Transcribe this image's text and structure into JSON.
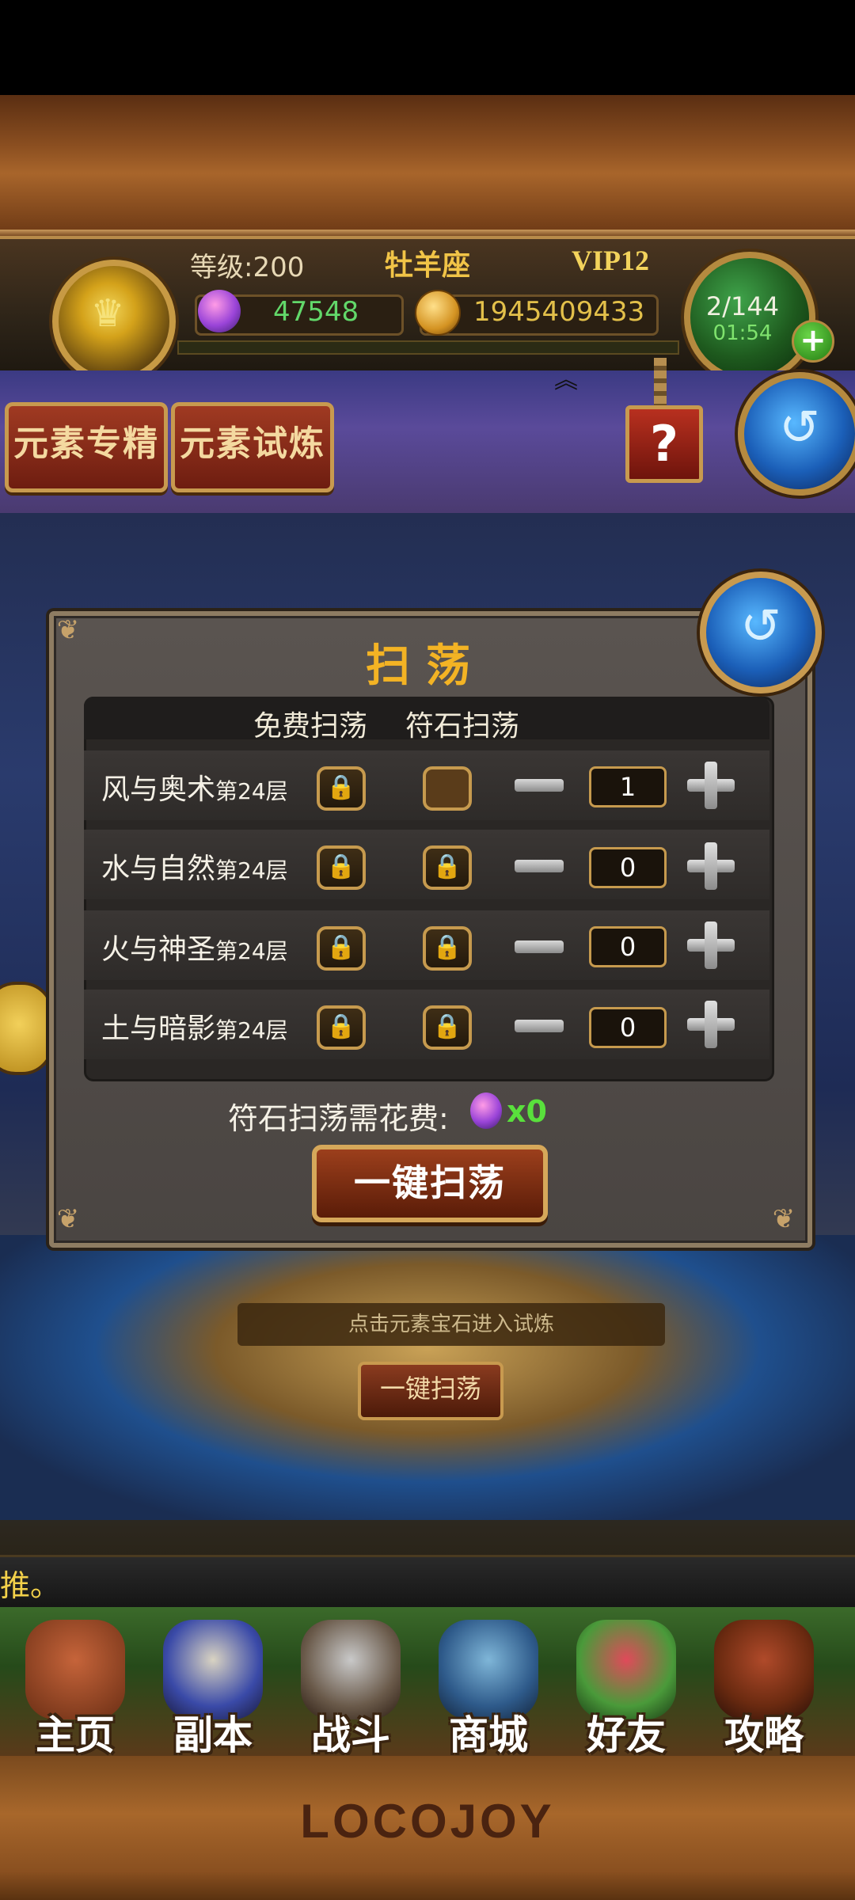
{
  "header": {
    "level": "等级:200",
    "nickname": "牡羊座",
    "vip": "VIP12",
    "gems": "47548",
    "gold": "1945409433",
    "energy": "2/144",
    "energy_timer": "01:54",
    "energy_plus": "+"
  },
  "tabs": {
    "element_mastery": "元素专精",
    "element_trial": "元素试炼",
    "help": "?"
  },
  "background": {
    "hint": "点击元素宝石进入试炼",
    "sweep_button": "一键扫荡"
  },
  "marquee": {
    "text": "推。"
  },
  "modal": {
    "title": "扫荡",
    "col_free": "免费扫荡",
    "col_rune": "符石扫荡",
    "rows": [
      {
        "name": "风与奥术",
        "floor": "第24层",
        "count": "1"
      },
      {
        "name": "水与自然",
        "floor": "第24层",
        "count": "0"
      },
      {
        "name": "火与神圣",
        "floor": "第24层",
        "count": "0"
      },
      {
        "name": "土与暗影",
        "floor": "第24层",
        "count": "0"
      }
    ],
    "cost_label": "符石扫荡需花费:",
    "cost_value": "x0",
    "sweep_button": "一键扫荡"
  },
  "nav": {
    "items": [
      {
        "label": "主页"
      },
      {
        "label": "副本"
      },
      {
        "label": "战斗"
      },
      {
        "label": "商城"
      },
      {
        "label": "好友"
      },
      {
        "label": "攻略"
      }
    ]
  },
  "brand": "LOCOJOY",
  "icons": {
    "lock": "lock-icon",
    "refresh": "refresh-icon",
    "gem": "gem-icon",
    "coin": "coin-icon"
  }
}
